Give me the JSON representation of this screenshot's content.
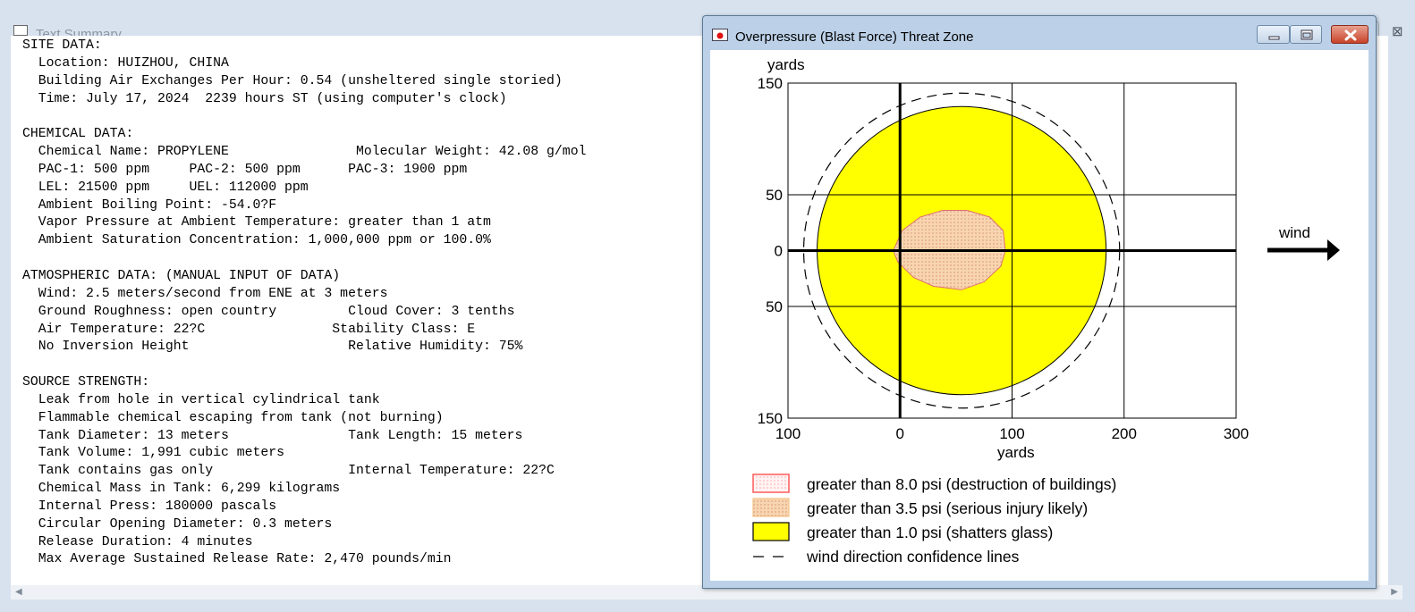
{
  "summary_window": {
    "title": "Text Summary",
    "lines": [
      "SITE DATA:",
      "  Location: HUIZHOU, CHINA",
      "  Building Air Exchanges Per Hour: 0.54 (unsheltered single storied)",
      "  Time: July 17, 2024  2239 hours ST (using computer's clock)",
      "",
      "CHEMICAL DATA:",
      "  Chemical Name: PROPYLENE                Molecular Weight: 42.08 g/mol",
      "  PAC-1: 500 ppm     PAC-2: 500 ppm      PAC-3: 1900 ppm",
      "  LEL: 21500 ppm     UEL: 112000 ppm",
      "  Ambient Boiling Point: -54.0?F",
      "  Vapor Pressure at Ambient Temperature: greater than 1 atm",
      "  Ambient Saturation Concentration: 1,000,000 ppm or 100.0%",
      "",
      "ATMOSPHERIC DATA: (MANUAL INPUT OF DATA)",
      "  Wind: 2.5 meters/second from ENE at 3 meters",
      "  Ground Roughness: open country         Cloud Cover: 3 tenths",
      "  Air Temperature: 22?C                Stability Class: E",
      "  No Inversion Height                    Relative Humidity: 75%",
      "",
      "SOURCE STRENGTH:",
      "  Leak from hole in vertical cylindrical tank",
      "  Flammable chemical escaping from tank (not burning)",
      "  Tank Diameter: 13 meters               Tank Length: 15 meters",
      "  Tank Volume: 1,991 cubic meters",
      "  Tank contains gas only                 Internal Temperature: 22?C",
      "  Chemical Mass in Tank: 6,299 kilograms",
      "  Internal Press: 180000 pascals",
      "  Circular Opening Diameter: 0.3 meters",
      "  Release Duration: 4 minutes",
      "  Max Average Sustained Release Rate: 2,470 pounds/min"
    ]
  },
  "threat_window": {
    "title": "Overpressure (Blast Force) Threat Zone"
  },
  "chart_data": {
    "type": "area",
    "xlabel": "yards",
    "ylabel": "yards",
    "xlim": [
      -100,
      300
    ],
    "ylim": [
      -150,
      150
    ],
    "x_ticks": [
      {
        "value": -100,
        "label": "100"
      },
      {
        "value": 0,
        "label": "0"
      },
      {
        "value": 100,
        "label": "100"
      },
      {
        "value": 200,
        "label": "200"
      },
      {
        "value": 300,
        "label": "300"
      }
    ],
    "y_ticks": [
      {
        "value": 150,
        "label": "150"
      },
      {
        "value": 50,
        "label": "50"
      },
      {
        "value": 0,
        "label": "0"
      },
      {
        "value": -50,
        "label": "50"
      },
      {
        "value": -150,
        "label": "150"
      }
    ],
    "grid": true,
    "zones": {
      "yellow": {
        "cx": 55,
        "cy": 0,
        "r": 129
      },
      "orange": [
        [
          -6,
          0
        ],
        [
          2,
          18
        ],
        [
          18,
          30
        ],
        [
          38,
          36
        ],
        [
          60,
          36
        ],
        [
          80,
          30
        ],
        [
          92,
          18
        ],
        [
          94,
          0
        ],
        [
          90,
          -14
        ],
        [
          75,
          -28
        ],
        [
          55,
          -35
        ],
        [
          30,
          -32
        ],
        [
          12,
          -24
        ],
        [
          -2,
          -10
        ]
      ],
      "confidence_lines": {
        "cx": 55,
        "cy": 0,
        "r": 141
      }
    },
    "legend": [
      {
        "label": "greater than 8.0 psi (destruction of buildings)",
        "color": "#ff5a5a"
      },
      {
        "label": "greater than 3.5 psi (serious injury likely)",
        "color": "#f5c48a"
      },
      {
        "label": "greater than 1.0 psi (shatters glass)",
        "color": "#ffff00"
      },
      {
        "label": "wind direction confidence lines",
        "color": "#000000"
      }
    ],
    "wind_label": "wind"
  }
}
